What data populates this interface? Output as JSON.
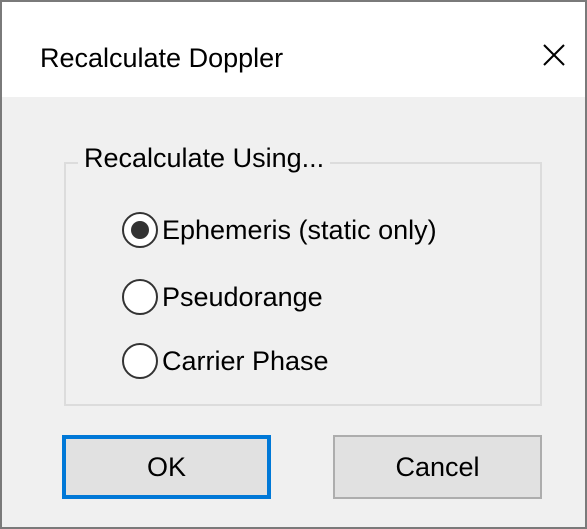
{
  "window": {
    "title": "Recalculate Doppler",
    "close_icon": "close-icon"
  },
  "group": {
    "legend": "Recalculate Using...",
    "options": [
      {
        "label": "Ephemeris (static only)",
        "selected": true
      },
      {
        "label": "Pseudorange",
        "selected": false
      },
      {
        "label": "Carrier Phase",
        "selected": false
      }
    ]
  },
  "buttons": {
    "ok_label": "OK",
    "cancel_label": "Cancel"
  },
  "colors": {
    "focus_accent": "#0078d7",
    "dialog_bg": "#f0f0f0",
    "titlebar_bg": "#ffffff"
  }
}
